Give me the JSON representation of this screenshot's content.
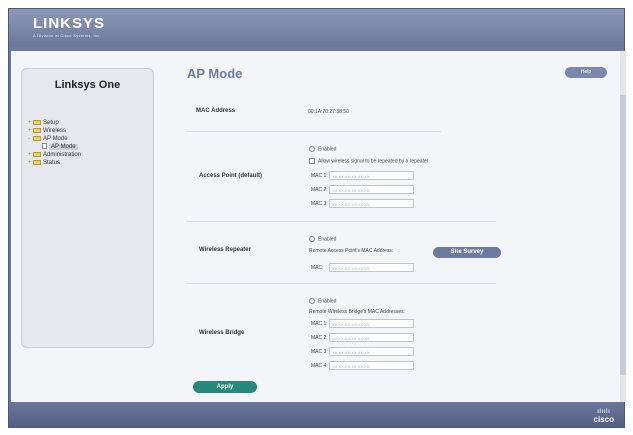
{
  "brand": {
    "logo": "LINKSYS",
    "logo_sub": "A Division of Cisco Systems, Inc.",
    "footer_brand": "cisco",
    "footer_bars": "ılıılı"
  },
  "sidebar": {
    "title": "Linksys One",
    "items": [
      {
        "label": "Setup"
      },
      {
        "label": "Wireless"
      },
      {
        "label": "AP Mode"
      },
      {
        "label": "AP Mode",
        "selected": true
      },
      {
        "label": "Administration"
      },
      {
        "label": "Status"
      }
    ]
  },
  "main": {
    "title": "AP Mode",
    "help": "Help",
    "mac_address": {
      "label": "MAC Address",
      "value": "00:1A:70:27:38:50"
    },
    "access_point": {
      "label": "Access Point (default)",
      "enabled": "Enabled",
      "allow": "Allow wireless signal to be repeated by a repeater",
      "macs": [
        {
          "label": "MAC 1:",
          "placeholder": "XX:XX:XX:XX:XX:XX"
        },
        {
          "label": "MAC 2:",
          "placeholder": "XX:XX:XX:XX:XX:XX"
        },
        {
          "label": "MAC 3:",
          "placeholder": "XX:XX:XX:XX:XX:XX"
        }
      ]
    },
    "repeater": {
      "label": "Wireless Repeater",
      "enabled": "Enabled",
      "remote": "Remote Access Point's MAC Address:",
      "site_survey": "Site Survey",
      "mac": {
        "label": "MAC:",
        "placeholder": "XX:XX:XX:XX:XX:XX"
      }
    },
    "bridge": {
      "label": "Wireless Bridge",
      "enabled": "Enabled",
      "remote": "Remote Wireless Bridge's MAC Addresses:",
      "macs": [
        {
          "label": "MAC 1:",
          "placeholder": "XX:XX:XX:XX:XX:XX"
        },
        {
          "label": "MAC 2:",
          "placeholder": "XX:XX:XX:XX:XX:XX"
        },
        {
          "label": "MAC 3:",
          "placeholder": "XX:XX:XX:XX:XX:XX"
        },
        {
          "label": "MAC 4:",
          "placeholder": "XX:XX:XX:XX:XX:XX"
        }
      ]
    },
    "apply": "Apply"
  },
  "colors": {
    "frame": "#6d7a9e",
    "title_text": "#6d7aa4",
    "apply_button": "#27897c",
    "button": "#6f7aa0"
  }
}
